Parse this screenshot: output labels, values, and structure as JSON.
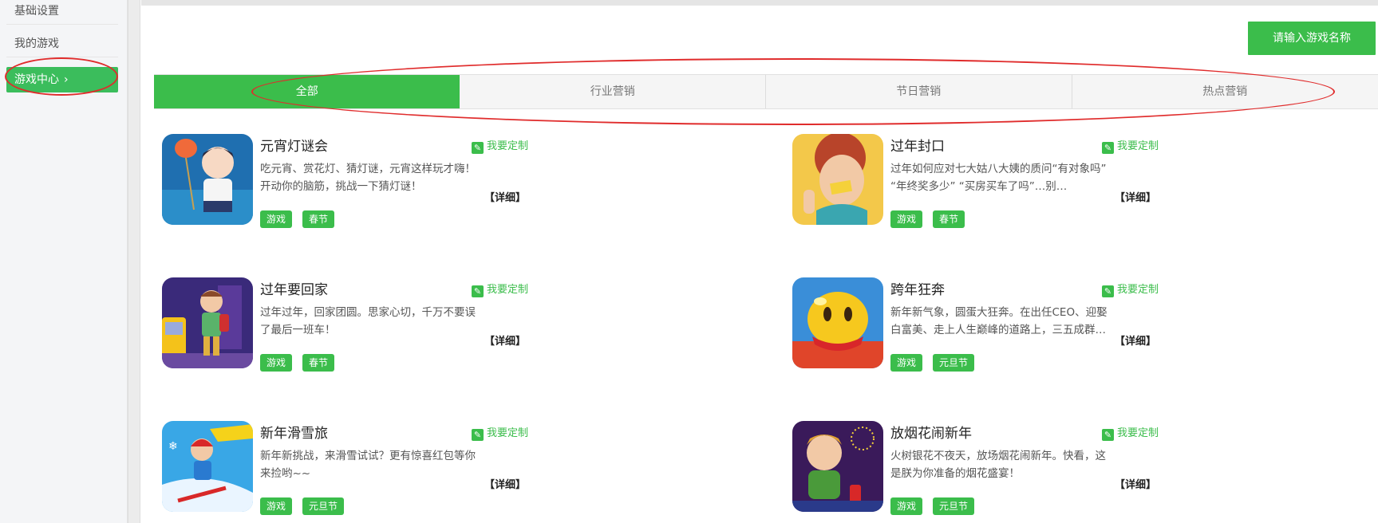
{
  "sidebar": {
    "items": [
      {
        "label": "基础设置"
      },
      {
        "label": "我的游戏"
      },
      {
        "label": "游戏中心",
        "chevron": "›"
      }
    ]
  },
  "search": {
    "label": "请输入游戏名称"
  },
  "tabs": [
    {
      "label": "全部"
    },
    {
      "label": "行业营销"
    },
    {
      "label": "节日营销"
    },
    {
      "label": "热点营销"
    }
  ],
  "customize_label": "我要定制",
  "detail_label": "【详细】",
  "games": [
    {
      "title": "元宵灯谜会",
      "desc": "吃元宵、赏花灯、猜灯谜，元宵这样玩才嗨！开动你的脑筋，挑战一下猜灯谜！",
      "tags": [
        "游戏",
        "春节"
      ]
    },
    {
      "title": "过年封口",
      "desc": "过年如何应对七大姑八大姨的质问“有对象吗” “年终奖多少” “买房买车了吗”…别…",
      "tags": [
        "游戏",
        "春节"
      ]
    },
    {
      "title": "过年要回家",
      "desc": "过年过年，回家团圆。思家心切，千万不要误了最后一班车！",
      "tags": [
        "游戏",
        "春节"
      ]
    },
    {
      "title": "跨年狂奔",
      "desc": "新年新气象，圆蛋大狂奔。在出任CEO、迎娶白富美、走上人生巅峰的道路上，三五成群…",
      "tags": [
        "游戏",
        "元旦节"
      ]
    },
    {
      "title": "新年滑雪旅",
      "desc": "新年新挑战，来滑雪试试？更有惊喜红包等你来捡哟~~",
      "tags": [
        "游戏",
        "元旦节"
      ]
    },
    {
      "title": "放烟花闹新年",
      "desc": "火树银花不夜天，放场烟花闹新年。快看，这是朕为你准备的烟花盛宴！",
      "tags": [
        "游戏",
        "元旦节"
      ]
    }
  ],
  "colors": {
    "accent": "#3bbd4b",
    "annotation": "#e02c2c"
  }
}
